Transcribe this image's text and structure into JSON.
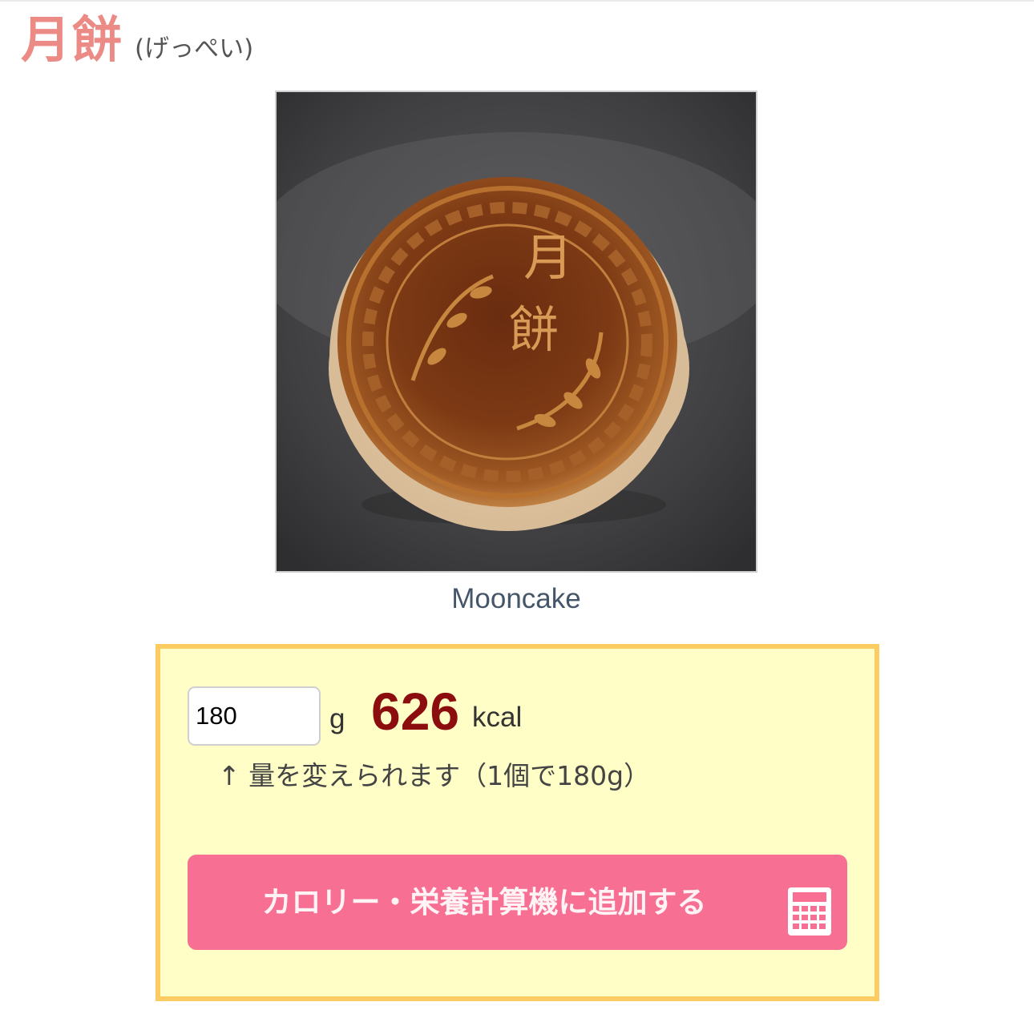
{
  "food": {
    "name": "月餅",
    "reading": "(げっぺい)",
    "caption": "Mooncake",
    "photo": {
      "stamp_text_top": "月",
      "stamp_text_bottom": "餅"
    }
  },
  "calculator": {
    "quantity_value": "180",
    "quantity_unit": "g",
    "kcal_value": "626",
    "kcal_unit": "kcal",
    "hint": "↑ 量を変えられます（1個で180g）",
    "add_button_label": "カロリー・栄養計算機に追加する",
    "add_button_icon": "calculator-icon"
  },
  "colors": {
    "title": "#ec8a86",
    "kcal": "#8c0d0d",
    "panel_background": "#fffec7",
    "panel_border": "#fccc63",
    "button": "#f77094"
  }
}
